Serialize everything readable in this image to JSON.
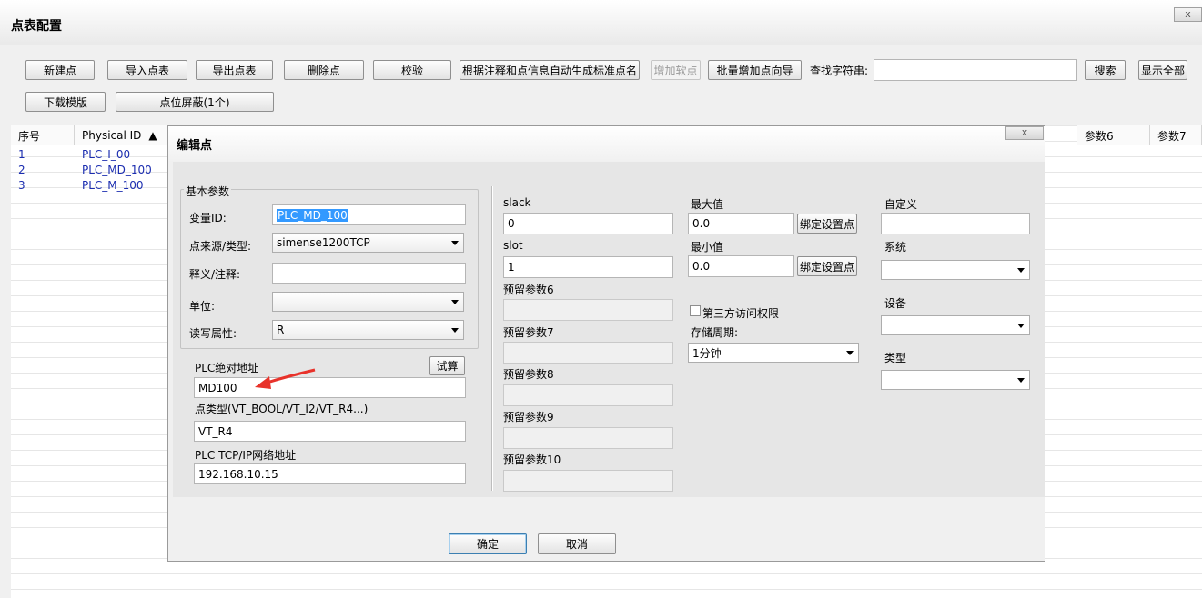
{
  "window": {
    "title": "点表配置",
    "close": "x"
  },
  "toolbar": {
    "buttons": [
      "新建点",
      "导入点表",
      "导出点表",
      "删除点",
      "校验",
      "根据注释和点信息自动生成标准点名",
      "增加软点",
      "批量增加点向导"
    ],
    "search_label": "查找字符串:",
    "search_value": "",
    "search_button": "搜索",
    "show_all_button": "显示全部",
    "row2": [
      "下载模版",
      "点位屏蔽(1个)"
    ]
  },
  "table": {
    "columns": [
      "序号",
      "Physical ID"
    ],
    "sort_indicator": "▲",
    "right_columns": [
      "参数6",
      "参数7"
    ],
    "rows": [
      {
        "index": "1",
        "id": "PLC_I_00"
      },
      {
        "index": "2",
        "id": "PLC_MD_100"
      },
      {
        "index": "3",
        "id": "PLC_M_100"
      }
    ]
  },
  "dialog": {
    "title": "编辑点",
    "close": "x",
    "basic": {
      "group_title": "基本参数",
      "var_id_label": "变量ID:",
      "var_id_value": "PLC_MD_100",
      "source_label": "点来源/类型:",
      "source_value": "simense1200TCP",
      "desc_label": "释义/注释:",
      "desc_value": "",
      "unit_label": "单位:",
      "unit_value": "",
      "rw_label": "读写属性:",
      "rw_value": "R"
    },
    "plc": {
      "addr_label": "PLC绝对地址",
      "calc_button": "试算",
      "addr_value": "MD100",
      "type_label": "点类型(VT_BOOL/VT_I2/VT_R4...)",
      "type_value": "VT_R4",
      "net_label": "PLC TCP/IP网络地址",
      "net_value": "192.168.10.15"
    },
    "middle": {
      "slack_label": "slack",
      "slack_value": "0",
      "slot_label": "slot",
      "slot_value": "1",
      "reserved": [
        "预留参数6",
        "预留参数7",
        "预留参数8",
        "预留参数9",
        "预留参数10"
      ]
    },
    "limits": {
      "max_label": "最大值",
      "max_value": "0.0",
      "min_label": "最小值",
      "min_value": "0.0",
      "bind_button": "绑定设置点",
      "third_party_label": "第三方访问权限",
      "third_party_checked": false,
      "period_label": "存储周期:",
      "period_value": "1分钟"
    },
    "right": {
      "custom_label": "自定义",
      "custom_value": "",
      "system_label": "系统",
      "system_value": "",
      "device_label": "设备",
      "device_value": "",
      "type_label": "类型",
      "type_value": ""
    },
    "ok_button": "确定",
    "cancel_button": "取消"
  },
  "colors": {
    "arrow": "#e8322a",
    "link_text": "#1b2db0",
    "selection": "#3399ff"
  }
}
